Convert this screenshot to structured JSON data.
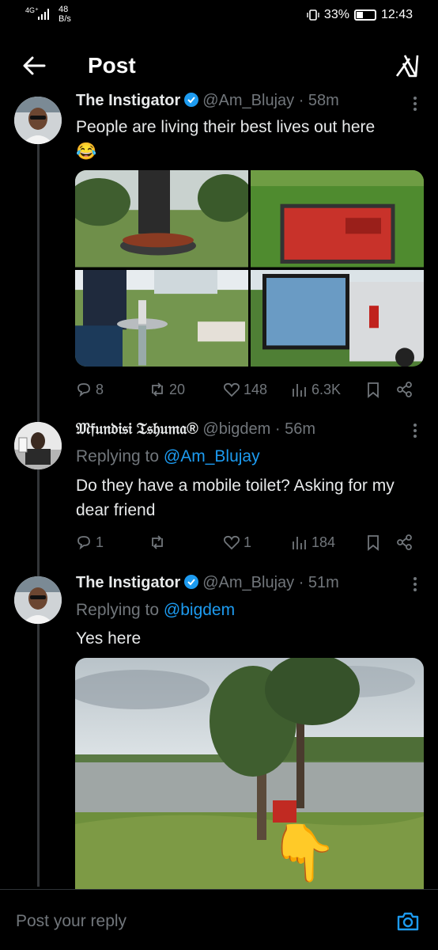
{
  "status_bar": {
    "network": "4G⁺",
    "speed_value": "48",
    "speed_unit": "B/s",
    "battery": "33%",
    "battery_level": 0.33,
    "time": "12:43"
  },
  "header": {
    "title": "Post",
    "back_icon": "arrow-left-icon",
    "grok_icon": "grok-icon"
  },
  "posts": [
    {
      "name": "The Instigator",
      "handle": "@Am_Blujay",
      "time": "· 58m",
      "verified": true,
      "text": "People are living their best lives out here",
      "emoji": "😂",
      "stats": {
        "replies": "8",
        "reposts": "20",
        "likes": "148",
        "views": "6.3K"
      }
    },
    {
      "name": "𝔐𝔣𝔲𝔫𝔡𝔦𝔰𝔦 𝔗𝔰𝔥𝔲𝔪𝔞®",
      "handle": "@bigdem",
      "time": "· 56m",
      "verified": false,
      "replying_label": "Replying to",
      "replying_to": "@Am_Blujay",
      "text": "Do they have a mobile toilet? Asking for my dear friend",
      "stats": {
        "replies": "1",
        "reposts": "",
        "likes": "1",
        "views": "184"
      }
    },
    {
      "name": "The Instigator",
      "handle": "@Am_Blujay",
      "time": "· 51m",
      "verified": true,
      "replying_label": "Replying to",
      "replying_to": "@bigdem",
      "text": "Yes here"
    }
  ],
  "reply_bar": {
    "placeholder": "Post your reply",
    "icon": "camera-icon"
  },
  "colors": {
    "accent": "#1d9bf0",
    "background": "#000000",
    "muted": "#71767b"
  }
}
